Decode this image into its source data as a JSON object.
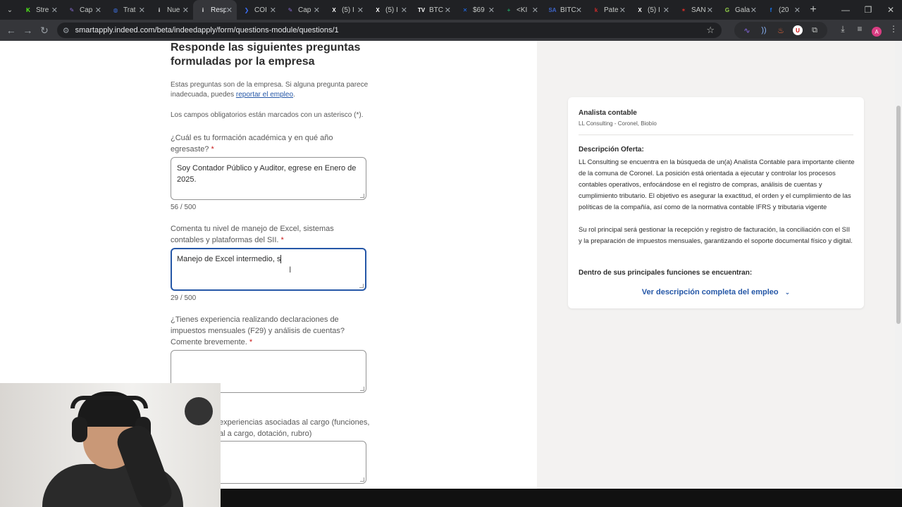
{
  "browser": {
    "tabs": [
      {
        "label": "Stre",
        "color": "#53fc18",
        "glyph": "K"
      },
      {
        "label": "Cap",
        "color": "#8a6fd8",
        "glyph": "✎"
      },
      {
        "label": "Trat",
        "color": "#3c6cd6",
        "glyph": "◍"
      },
      {
        "label": "Nue",
        "color": "#ffffff",
        "glyph": "i"
      },
      {
        "label": "Resp",
        "color": "#ffffff",
        "glyph": "i",
        "active": true
      },
      {
        "label": "COI",
        "color": "#3b6ef5",
        "glyph": "❯"
      },
      {
        "label": "Cap",
        "color": "#8a6fd8",
        "glyph": "✎"
      },
      {
        "label": "(5) I",
        "color": "#ffffff",
        "glyph": "X"
      },
      {
        "label": "(5) I",
        "color": "#ffffff",
        "glyph": "X"
      },
      {
        "label": "BTC",
        "color": "#ffffff",
        "glyph": "TV"
      },
      {
        "label": "$69",
        "color": "#1f6ff5",
        "glyph": "✕"
      },
      {
        "label": "<KI",
        "color": "#1ea362",
        "glyph": "+"
      },
      {
        "label": "BITC",
        "color": "#3d64c9",
        "glyph": "SA"
      },
      {
        "label": "Pate",
        "color": "#d02a2a",
        "glyph": "k"
      },
      {
        "label": "(5) I",
        "color": "#ffffff",
        "glyph": "X"
      },
      {
        "label": "SAN",
        "color": "#e0302a",
        "glyph": "✶"
      },
      {
        "label": "Gala",
        "color": "#95d44a",
        "glyph": "G"
      },
      {
        "label": "(20",
        "color": "#1877f2",
        "glyph": "f"
      }
    ],
    "url": "smartapply.indeed.com/beta/indeedapply/form/questions-module/questions/1",
    "profile_initial": "A"
  },
  "form": {
    "title": "Responde las siguientes preguntas formuladas por la empresa",
    "intro_text": "Estas preguntas son de la empresa. Si alguna pregunta parece inadecuada, puedes ",
    "report_link": "reportar el empleo",
    "intro_end": ".",
    "required_note": "Los campos obligatorios están marcados con un asterisco (*).",
    "questions": [
      {
        "label": "¿Cuál es tu formación académica y en qué año egresaste?",
        "answer": "Soy Contador Público y Auditor, egrese en Enero de 2025.",
        "count": "56 / 500"
      },
      {
        "label": "Comenta tu nivel de manejo de Excel, sistemas contables y plataformas del SII.",
        "answer": "Manejo de Excel intermedio, s",
        "count": "29 / 500"
      },
      {
        "label": "¿Tienes experiencia realizando declaraciones de impuestos mensuales (F29) y análisis de cuentas? Comente brevemente.",
        "answer": ""
      },
      {
        "label": "experiencias asociadas al cargo (funciones, al a cargo, dotación, rubro)",
        "answer": ""
      }
    ],
    "asterisk": "*"
  },
  "job": {
    "title": "Analista contable",
    "company": "LL Consulting - Coronel, Biobío",
    "desc_heading": "Descripción Oferta:",
    "desc_p1": "LL Consulting se encuentra en la búsqueda de un(a) Analista Contable para importante cliente de la comuna de Coronel. La posición está orientada a ejecutar y controlar los procesos contables operativos, enfocándose en el registro de compras, análisis de cuentas y cumplimiento tributario. El objetivo es asegurar la exactitud, el orden y el cumplimiento de las políticas de la compañía, así como de la normativa contable IFRS y tributaria vigente",
    "desc_p2": "Su rol principal será gestionar la recepción y registro de facturación, la conciliación con el SII y la preparación de impuestos mensuales, garantizando el soporte documental físico y digital.",
    "functions_heading": "Dentro de sus principales funciones se encuentran:",
    "see_more": "Ver descripción completa del empleo"
  }
}
